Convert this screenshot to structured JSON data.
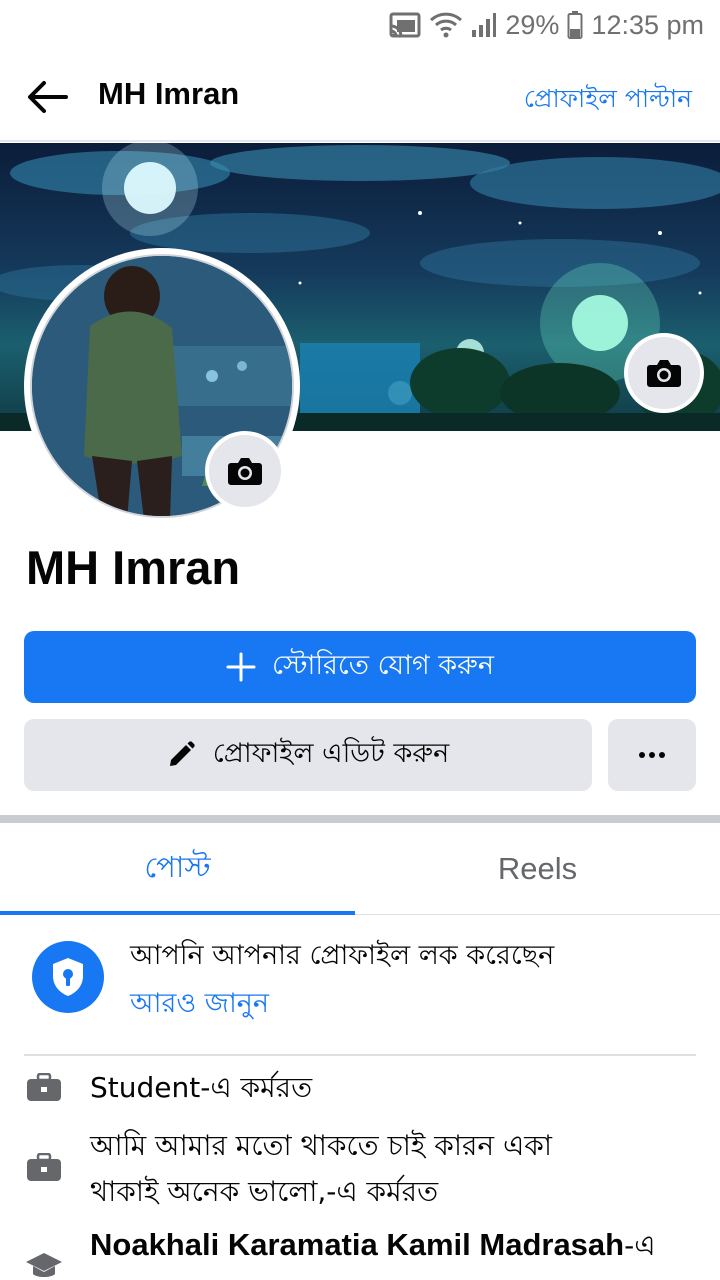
{
  "status_bar": {
    "battery": "29%",
    "time": "12:35 pm",
    "icons": [
      "cast-icon",
      "wifi-icon",
      "signal-icon",
      "battery-icon"
    ]
  },
  "header": {
    "back_icon": "arrow-left-icon",
    "title": "MH Imran",
    "switch_profile": "প্রোফাইল পাল্টান"
  },
  "profile": {
    "name": "MH Imran",
    "cover_camera_icon": "camera-icon",
    "avatar_camera_icon": "camera-icon"
  },
  "actions": {
    "add_story": "স্টোরিতে যোগ করুন",
    "edit_profile": "প্রোফাইল এডিট করুন",
    "more_icon": "more-horizontal-icon"
  },
  "tabs": [
    {
      "label": "পোস্ট",
      "active": true
    },
    {
      "label": "Reels",
      "active": false
    }
  ],
  "lock_notice": {
    "text": "আপনি আপনার প্রোফাইল লক করেছেন",
    "link": "আরও জানুন"
  },
  "info": [
    {
      "icon": "briefcase-icon",
      "line1": "Student-এ কর্মরত"
    },
    {
      "icon": "briefcase-icon",
      "line1": "আমি আমার মতো থাকতে চাই কারন একা",
      "line2": "থাকাই অনেক ভালো,-এ কর্মরত"
    },
    {
      "icon": "graduation-cap-icon",
      "bold": "Noakhali Karamatia Kamil Madrasah",
      "suffix": "-এ"
    }
  ],
  "colors": {
    "accent": "#1877f2",
    "button_gray": "#e4e6eb",
    "text": "#050505",
    "muted": "#65676b"
  }
}
